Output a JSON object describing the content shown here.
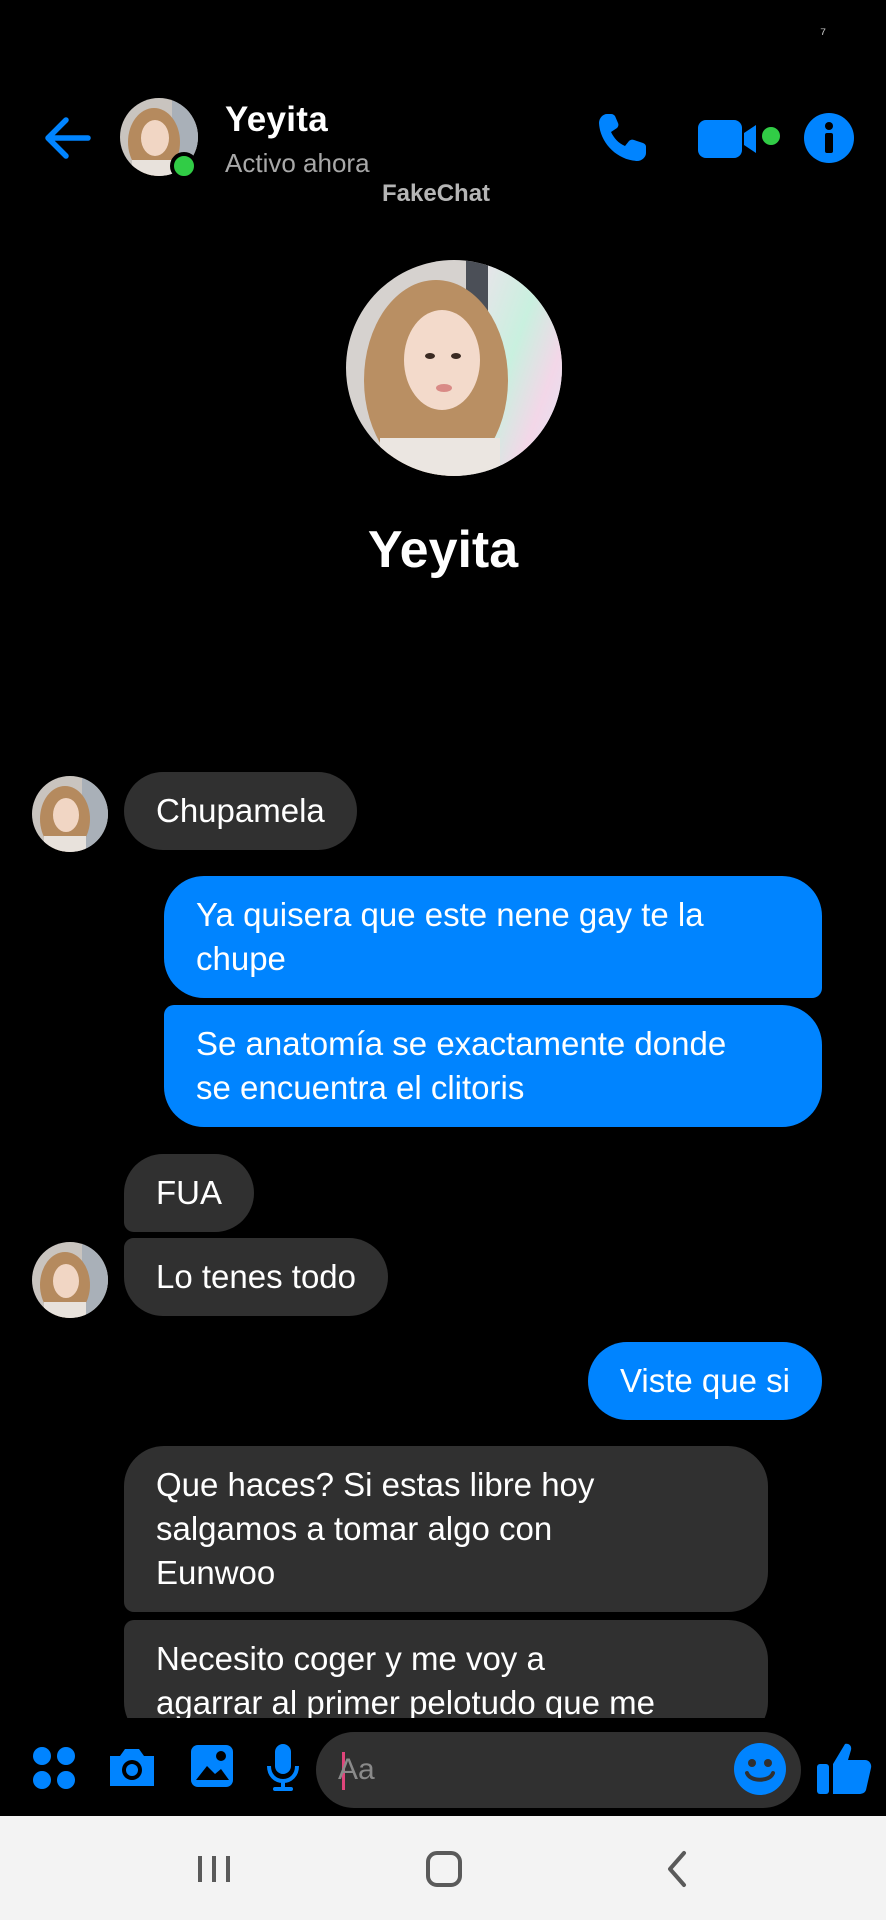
{
  "status_bar": {
    "glyph": "⁷"
  },
  "header": {
    "contact_name": "Yeyita",
    "status": "Activo ahora",
    "watermark": "FakeChat",
    "icons": [
      "arrow-left-icon",
      "phone-icon",
      "video-camera-icon",
      "info-icon"
    ]
  },
  "profile": {
    "name": "Yeyita"
  },
  "messages": [
    {
      "direction": "in",
      "lines": [
        "Chupamela"
      ]
    },
    {
      "direction": "out",
      "lines": [
        "Ya quisera que este nene gay te la",
        "chupe"
      ]
    },
    {
      "direction": "out",
      "lines": [
        "Se anatomía se exactamente donde",
        "se encuentra el clitoris"
      ]
    },
    {
      "direction": "in",
      "lines": [
        "FUA"
      ]
    },
    {
      "direction": "in",
      "lines": [
        "Lo tenes todo"
      ]
    },
    {
      "direction": "out",
      "lines": [
        "Viste que si"
      ]
    },
    {
      "direction": "in",
      "lines": [
        "Que haces? Si estas libre hoy",
        "salgamos a tomar algo con",
        "Eunwoo"
      ]
    },
    {
      "direction": "in",
      "lines": [
        "Necesito coger y me voy a",
        "agarrar al primer pelotudo que me"
      ]
    }
  ],
  "composer": {
    "placeholder": "Aa",
    "icons": [
      "apps-grid-icon",
      "camera-icon",
      "gallery-icon",
      "microphone-icon",
      "emoji-icon",
      "thumbs-up-icon"
    ]
  },
  "colors": {
    "accent": "#0084ff",
    "incoming_bubble": "#303030",
    "online": "#31cc46",
    "background": "#000000",
    "nav_bar": "#f3f3f3"
  }
}
